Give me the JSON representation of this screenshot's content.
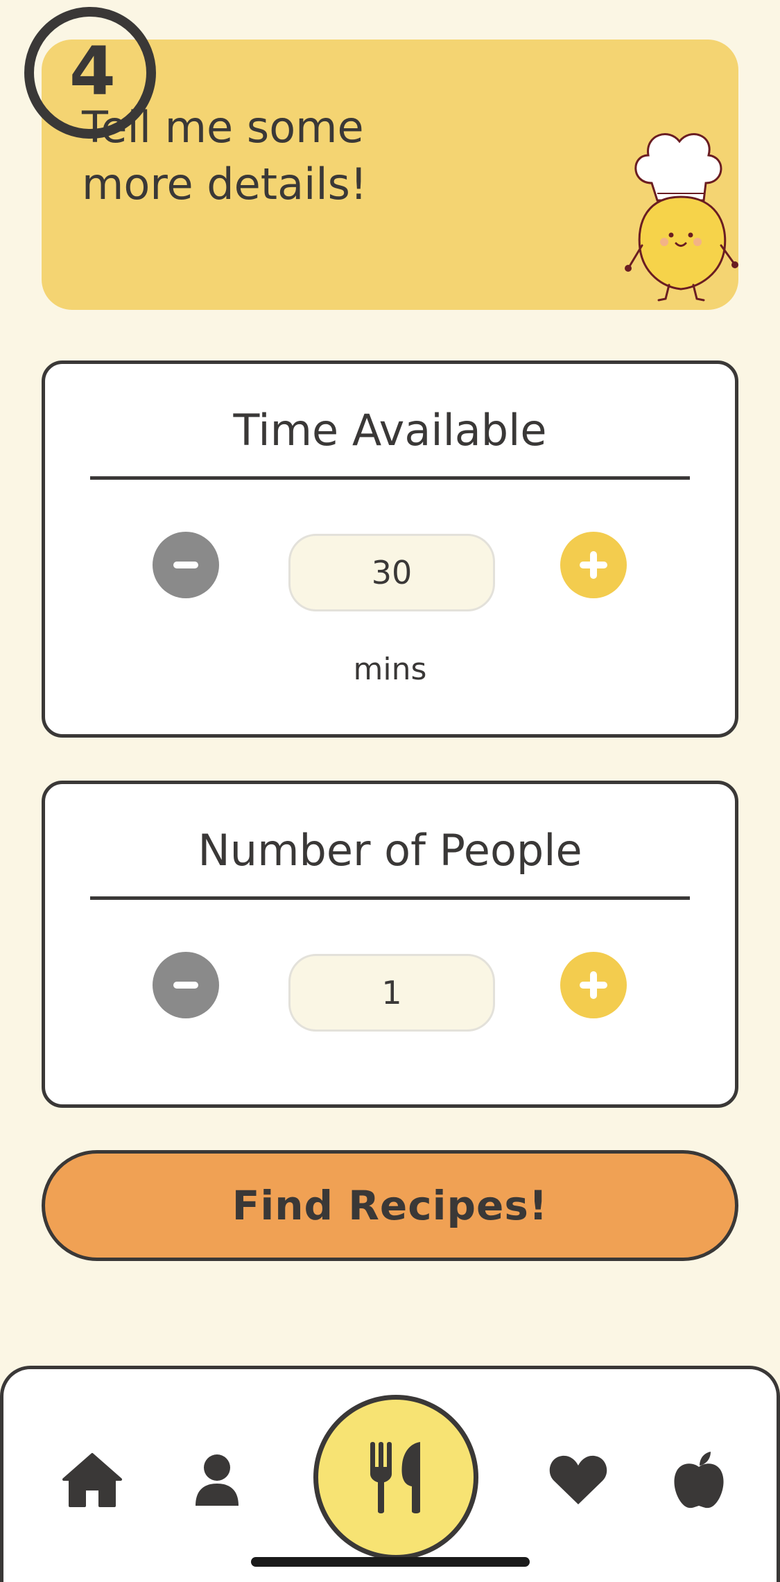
{
  "header": {
    "step_number": "4",
    "title_line1": "Tell me some",
    "title_line2": "more details!",
    "mascot_icon": "lemon-chef-mascot"
  },
  "time_card": {
    "title": "Time Available",
    "value": "30",
    "unit": "mins",
    "decrement_icon": "minus-icon",
    "increment_icon": "plus-icon"
  },
  "people_card": {
    "title": "Number of People",
    "value": "1",
    "decrement_icon": "minus-icon",
    "increment_icon": "plus-icon"
  },
  "cta": {
    "label": "Find Recipes!"
  },
  "bottom_nav": {
    "items": [
      {
        "icon": "home-icon"
      },
      {
        "icon": "profile-icon"
      },
      {
        "icon": "utensils-icon",
        "active": true
      },
      {
        "icon": "heart-icon"
      },
      {
        "icon": "apple-icon"
      }
    ]
  },
  "colors": {
    "background": "#fbf6e4",
    "banner": "#f4d472",
    "accent_yellow": "#f3cc4e",
    "cta_orange": "#f0a154",
    "dark": "#3a3837",
    "minus_gray": "#8a8a8a"
  }
}
